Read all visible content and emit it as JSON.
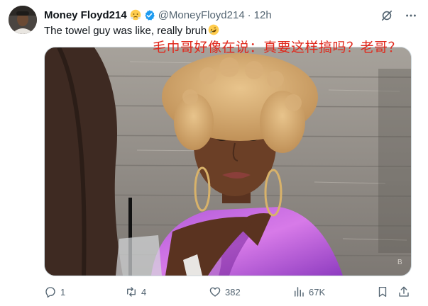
{
  "tweet": {
    "display_name": "Money Floyd214",
    "name_emoji": "face-with-steam-emoji",
    "verified": true,
    "handle": "@MoneyFloyd214",
    "separator": "·",
    "time": "12h",
    "text": "The towel guy was like, really bruh",
    "text_emoji": "rolling-on-floor-laughing-emoji",
    "overlay_caption": "毛巾哥好像在说：真要这样搞吗？老哥？"
  },
  "actions": {
    "replies": "1",
    "reposts": "4",
    "likes": "382",
    "views": "67K"
  },
  "colors": {
    "text": "#0f1419",
    "secondary": "#536471",
    "verified": "#1d9bf0",
    "caption": "#e0281c"
  }
}
